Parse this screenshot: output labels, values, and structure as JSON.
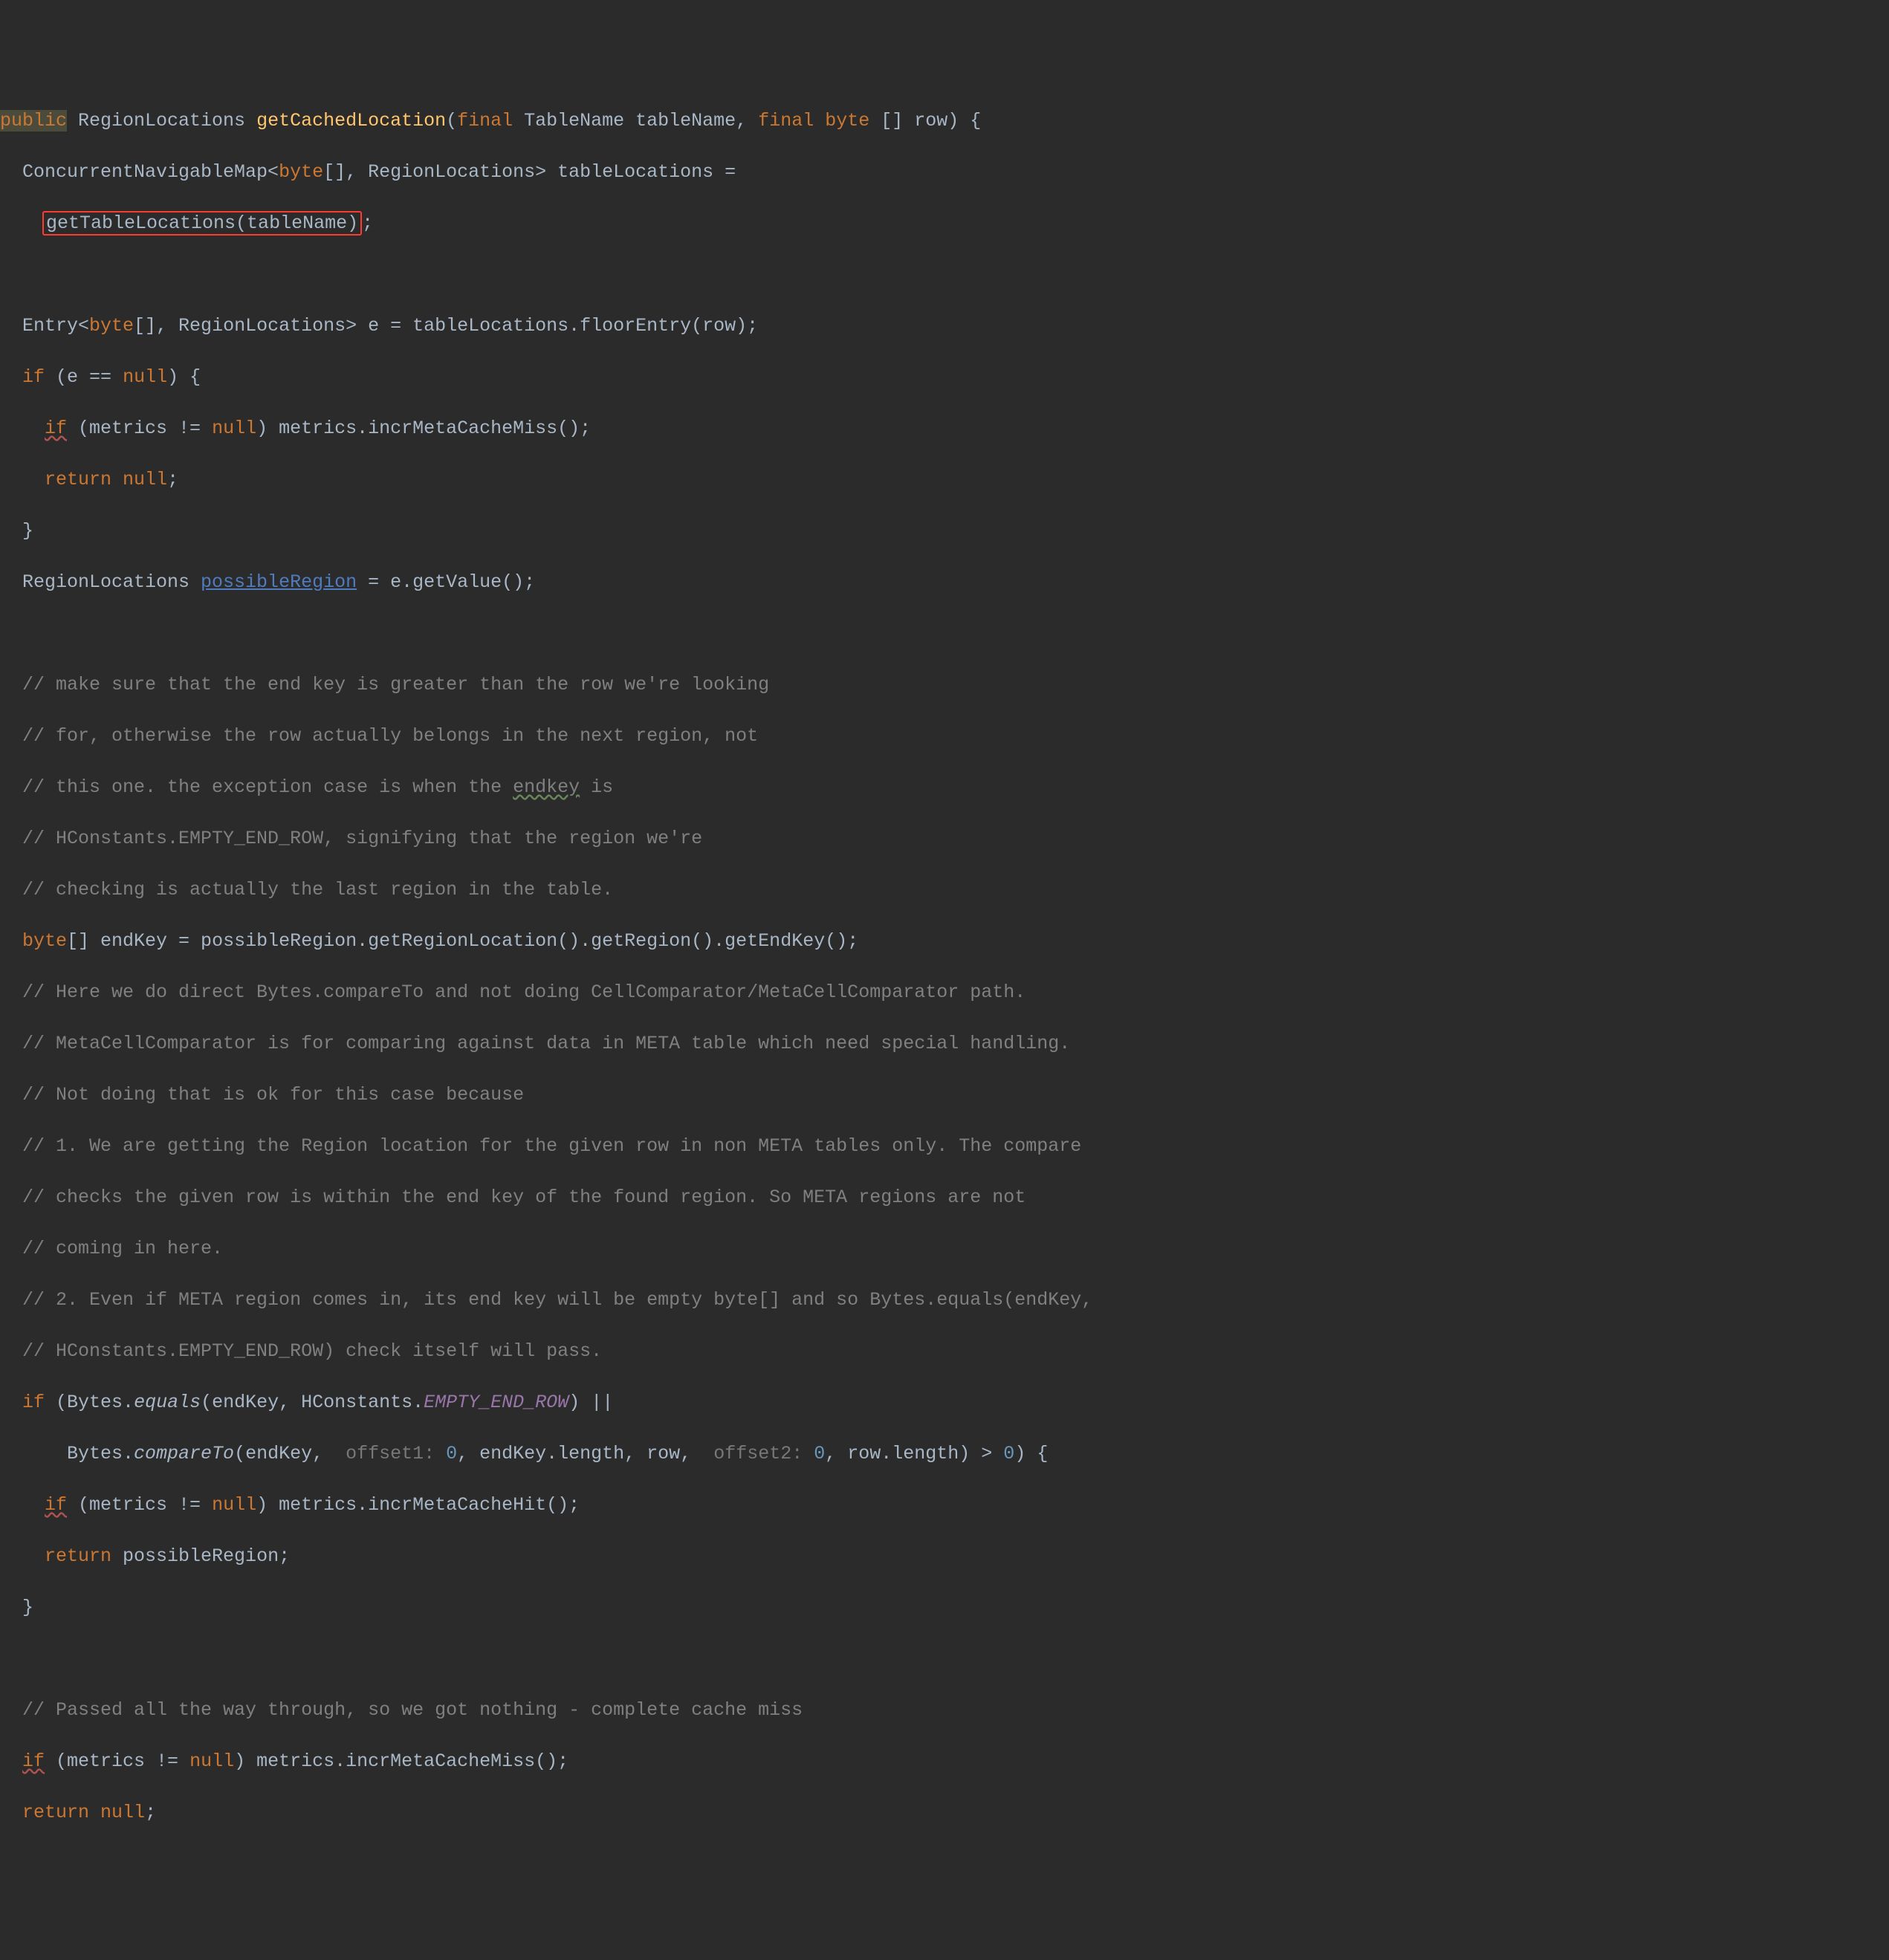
{
  "line1": {
    "public": "public",
    "a": " RegionLocations ",
    "fn": "getCachedLocation",
    "b": "(",
    "final1": "final",
    "c": " TableName tableName, ",
    "final2": "final",
    "d": " ",
    "byte": "byte",
    "e": " [] row) {"
  },
  "line2": {
    "a": "  ConcurrentNavigableMap<",
    "byte": "byte",
    "b": "[], RegionLocations> tableLocations ="
  },
  "line3": {
    "a": "    ",
    "box": "getTableLocations(tableName)",
    "b": ";"
  },
  "line5": {
    "a": "  Entry<",
    "byte": "byte",
    "b": "[], RegionLocations> e = tableLocations.floorEntry(row);"
  },
  "line6": {
    "a": "  ",
    "if": "if",
    "b": " (e == ",
    "null": "null",
    "c": ") {"
  },
  "line7": {
    "a": "    ",
    "if": "if",
    "b": " (metrics != ",
    "null": "null",
    "c": ") metrics.incrMetaCacheMiss();"
  },
  "line8": {
    "a": "    ",
    "return": "return ",
    "null": "null",
    "b": ";"
  },
  "line9": {
    "a": "  }"
  },
  "line10": {
    "a": "  RegionLocations ",
    "link": "possibleRegion",
    "b": " = e.getValue();"
  },
  "c1": "  // make sure that the end key is greater than the row we're looking",
  "c2": "  // for, otherwise the row actually belongs in the next region, not",
  "c3a": "  // this one. the exception case is when the ",
  "c3b": "endkey",
  "c3c": " is",
  "c4": "  // HConstants.EMPTY_END_ROW, signifying that the region we're",
  "c5": "  // checking is actually the last region in the table.",
  "line17": {
    "a": "  ",
    "byte": "byte",
    "b": "[] endKey = possibleRegion.getRegionLocation().getRegion().getEndKey();"
  },
  "c6": "  // Here we do direct Bytes.compareTo and not doing CellComparator/MetaCellComparator path.",
  "c7": "  // MetaCellComparator is for comparing against data in META table which need special handling.",
  "c8": "  // Not doing that is ok for this case because",
  "c9": "  // 1. We are getting the Region location for the given row in non META tables only. The compare",
  "c10": "  // checks the given row is within the end key of the found region. So META regions are not",
  "c11": "  // coming in here.",
  "c12": "  // 2. Even if META region comes in, its end key will be empty byte[] and so Bytes.equals(endKey,",
  "c13": "  // HConstants.EMPTY_END_ROW) check itself will pass.",
  "line26": {
    "a": "  ",
    "if": "if",
    "b": " (Bytes.",
    "equals": "equals",
    "c": "(endKey, HConstants.",
    "emptyend": "EMPTY_END_ROW",
    "d": ") ||"
  },
  "line27": {
    "a": "      Bytes.",
    "compare": "compareTo",
    "b": "(endKey, ",
    "h1": " offset1: ",
    "v1": "0",
    "c": ", endKey.length, row, ",
    "h2": " offset2: ",
    "v2": "0",
    "d": ", row.length) > ",
    "v3": "0",
    "e": ") {"
  },
  "line28": {
    "a": "    ",
    "if": "if",
    "b": " (metrics != ",
    "null": "null",
    "c": ") metrics.incrMetaCacheHit();"
  },
  "line29": {
    "a": "    ",
    "return": "return",
    "b": " possibleRegion;"
  },
  "line30": {
    "a": "  }"
  },
  "c14": "  // Passed all the way through, so we got nothing - complete cache miss",
  "line33": {
    "a": "  ",
    "if": "if",
    "b": " (metrics != ",
    "null": "null",
    "c": ") metrics.incrMetaCacheMiss();"
  },
  "line34": {
    "a": "  ",
    "return": "return ",
    "null": "null",
    "b": ";"
  }
}
